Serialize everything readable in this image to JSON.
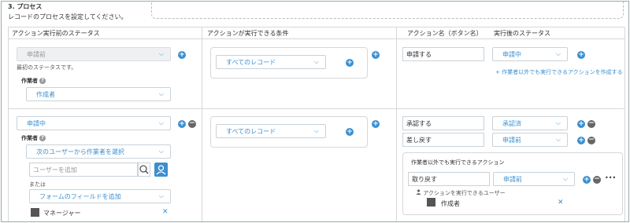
{
  "section": {
    "title": "3. プロセス",
    "description": "レコードのプロセスを設定してください。"
  },
  "headers": {
    "status_before": "アクション実行前のステータス",
    "condition": "アクションが実行できる条件",
    "action_name": "アクション名（ボタン名）",
    "status_after": "実行後のステータス"
  },
  "row1": {
    "status": "申請前",
    "initial_note": "最初のステータスです。",
    "assignee_label": "作業者",
    "assignee_value": "作成者",
    "condition": "すべてのレコード",
    "action_name": "申請する",
    "after_status": "申請中",
    "add_other_link": "作業者以外でも実行できるアクションを作成する"
  },
  "row2": {
    "status": "申請中",
    "assignee_label": "作業者",
    "assignee_mode": "次のユーザーから作業者を選択",
    "user_placeholder": "ユーザーを追加",
    "or_label": "または",
    "form_field_add": "フォームのフィールドを追加",
    "user_chip": "マネージャー",
    "condition": "すべてのレコード",
    "actions": [
      {
        "name": "承認する",
        "after": "承認済"
      },
      {
        "name": "差し戻す",
        "after": "申請前"
      }
    ],
    "other_panel": {
      "title": "作業者以外でも実行できるアクション",
      "action_name": "取り戻す",
      "after": "申請前",
      "users_label": "アクションを実行できるユーザー",
      "user_chip": "作成者"
    }
  },
  "icons": {
    "help": "?",
    "plus": "+",
    "minus": "−",
    "more": "•••",
    "close": "✕",
    "chevron": "⌵"
  },
  "colors": {
    "accent": "#3b8fd0",
    "border": "#c9d2d9"
  }
}
